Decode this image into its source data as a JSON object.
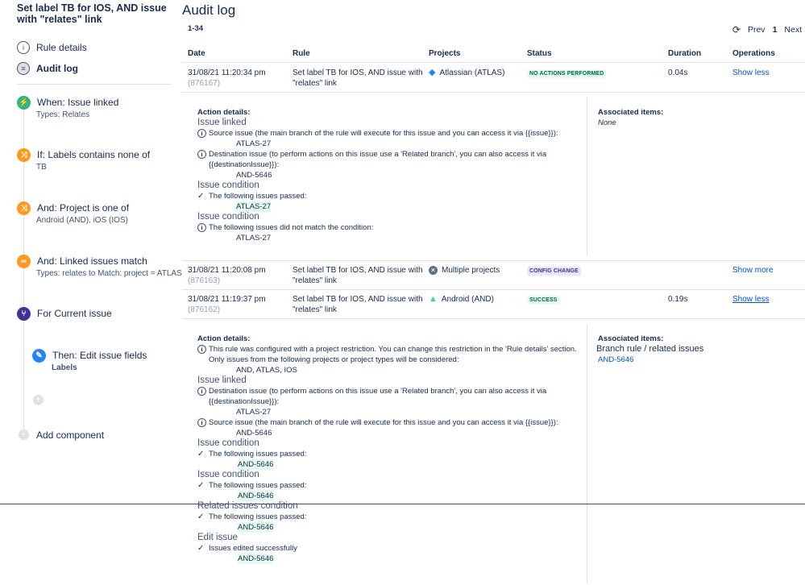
{
  "sidebar": {
    "rule_title": "Set label TB for IOS, AND issue with \"relates\" link",
    "nav": [
      {
        "label": "Rule details",
        "icon": "info-icon"
      },
      {
        "label": "Audit log",
        "icon": "audit-log-icon"
      }
    ],
    "components": [
      {
        "title": "When: Issue linked",
        "sub": "Types: Relates",
        "icon": "trigger-icon",
        "color": "#36b37e"
      },
      {
        "title": "If: Labels contains none of",
        "sub": "TB",
        "icon": "condition-icon",
        "color": "#ff991f"
      },
      {
        "title": "And: Project is one of",
        "sub": "Android (AND), iOS (IOS)",
        "icon": "condition-icon",
        "color": "#ff991f"
      },
      {
        "title": "And: Linked issues match",
        "sub": "Types: relates to Match: project = ATLAS",
        "icon": "link-icon",
        "color": "#ff991f"
      },
      {
        "title": "For Current issue",
        "sub": "",
        "icon": "branch-icon",
        "color": "#403294"
      },
      {
        "title": "Then: Edit issue fields",
        "sub": "Labels",
        "icon": "edit-icon",
        "color": "#2684ff"
      }
    ],
    "add_component": "Add component"
  },
  "main": {
    "title": "Audit log",
    "range": "1-34",
    "pager": {
      "prev": "Prev",
      "page": "1",
      "next": "Next"
    },
    "columns": [
      "Date",
      "Rule",
      "Projects",
      "Status",
      "Duration",
      "Operations"
    ],
    "rows": [
      {
        "date": "31/08/21 11:20:34 pm",
        "id": "(876167)",
        "rule": "Set label TB for IOS, AND issue with \"relates\" link",
        "project": "Atlassian (ATLAS)",
        "status": "NO ACTIONS PERFORMED",
        "duration": "0.04s",
        "op": "Show less"
      },
      {
        "date": "31/08/21 11:20:08 pm",
        "id": "(876163)",
        "rule": "Set label TB for IOS, AND issue with \"relates\" link",
        "project": "Multiple projects",
        "status": "CONFIG CHANGE",
        "duration": "",
        "op": "Show more"
      },
      {
        "date": "31/08/21 11:19:37 pm",
        "id": "(876162)",
        "rule": "Set label TB for IOS, AND issue with \"relates\" link",
        "project": "Android (AND)",
        "status": "SUCCESS",
        "duration": "0.19s",
        "op": "Show less"
      }
    ],
    "details1": {
      "label": "Action details:",
      "s1": "Issue linked",
      "m1": "Source issue (the main branch of the rule will execute for this issue and you can access it via {{issue}}):",
      "i1": "ATLAS-27",
      "m2a": "Destination issue (to perform actions on this issue use a 'Related branch', you can also access it via",
      "m2b": "{{destinationIssue}}):",
      "i2": "AND-5646",
      "s2": "Issue condition",
      "m3": "The following issues passed:",
      "i3": "ATLAS-27",
      "s3": "Issue condition",
      "m4": "The following issues did not match the condition:",
      "i4": "ATLAS-27",
      "assoc_label": "Associated items:",
      "assoc_value": "None"
    },
    "details3": {
      "label": "Action details:",
      "m1a": "This rule was configured with a project restriction. You can change this restriction in the 'Rule details' section.",
      "m1b": "Only issues from the following projects or project types will be considered:",
      "i1": "AND, ATLAS, IOS",
      "s1": "Issue linked",
      "m2a": "Destination issue (to perform actions on this issue use a 'Related branch', you can also access it via",
      "m2b": "{{destinationIssue}}):",
      "i2": "ATLAS-27",
      "m3": "Source issue (the main branch of the rule will execute for this issue and you can access it via {{issue}}):",
      "i3": "AND-5646",
      "s2": "Issue condition",
      "m4": "The following issues passed:",
      "i4": "AND-5646",
      "s3": "Issue condition",
      "m5": "The following issues passed:",
      "i5": "AND-5646",
      "s4": "Related issues condition",
      "m6": "The following issues passed:",
      "i6": "AND-5646",
      "s5": "Edit issue",
      "m7": "Issues edited successfully",
      "i7": "AND-5646",
      "assoc_label": "Associated items:",
      "assoc_value": "Branch rule / related issues",
      "assoc_link": "AND-5646"
    }
  }
}
